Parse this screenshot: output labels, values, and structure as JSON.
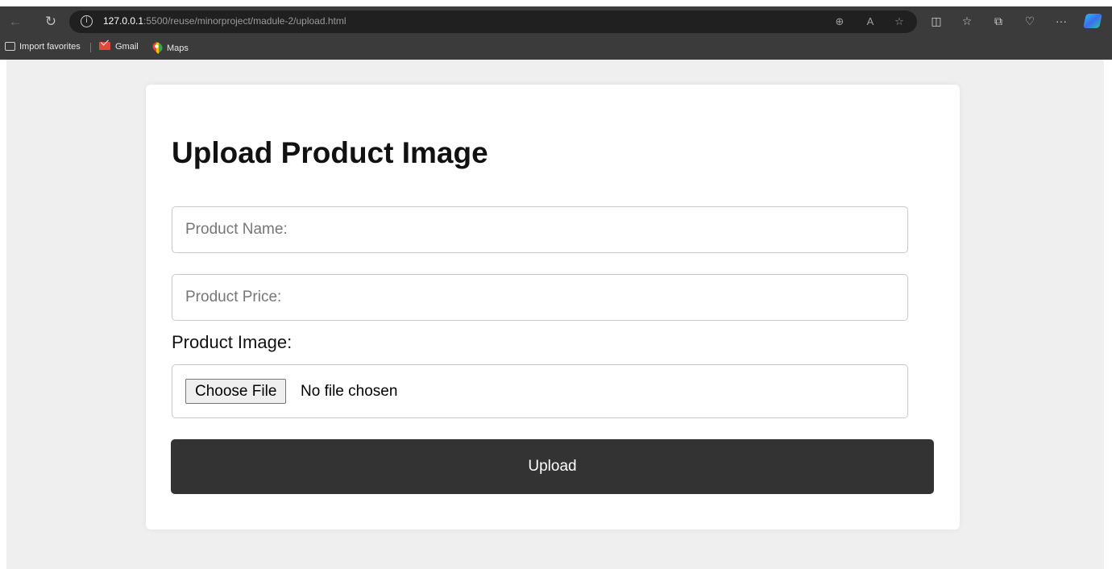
{
  "browser": {
    "url_host": "127.0.0.1",
    "url_rest": ":5500/reuse/minorproject/madule-2/upload.html",
    "bookmarks": [
      {
        "label": "Import favorites"
      },
      {
        "label": "Gmail"
      },
      {
        "label": "Maps"
      }
    ],
    "toolbar_icons": [
      "zoom-icon",
      "read-aloud-icon",
      "favorite-star-icon",
      "split-screen-icon",
      "favorites-icon",
      "collections-icon",
      "health-icon",
      "more-icon",
      "copilot-icon"
    ]
  },
  "form": {
    "title": "Upload Product Image",
    "name_placeholder": "Product Name:",
    "price_placeholder": "Product Price:",
    "image_label": "Product Image:",
    "choose_file_label": "Choose File",
    "no_file_text": "No file chosen",
    "upload_label": "Upload"
  }
}
